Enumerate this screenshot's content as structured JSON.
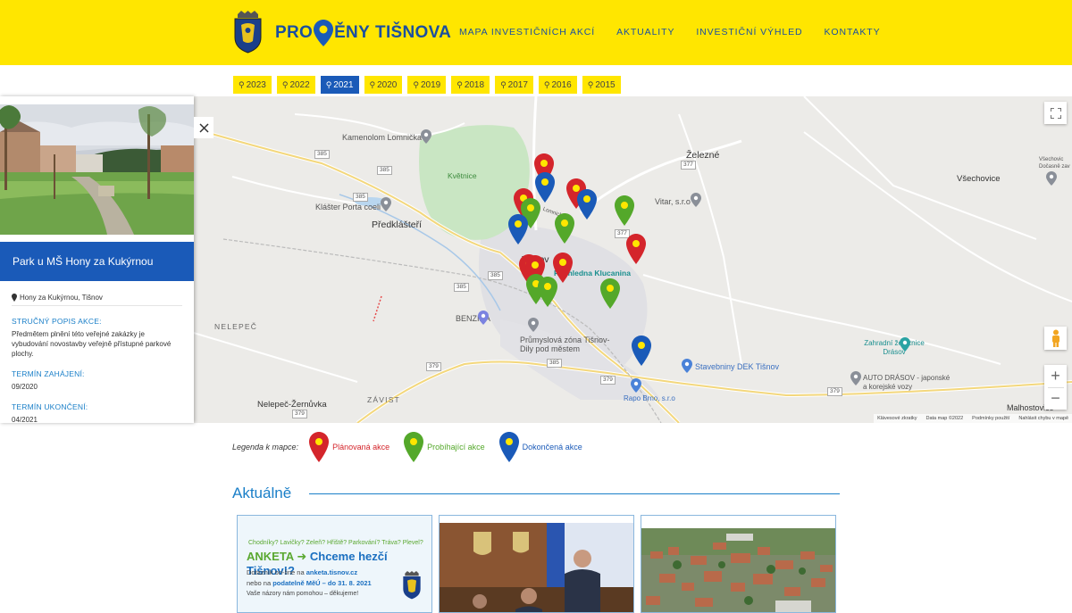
{
  "header": {
    "logo_part1": "PRO",
    "logo_part2": "ĚNY",
    "logo_part3": "TIŠNOVA",
    "nav": [
      "MAPA INVESTIČNÍCH AKCÍ",
      "AKTUALITY",
      "INVESTIČNÍ VÝHLED",
      "KONTAKTY"
    ]
  },
  "years": {
    "items": [
      "2023",
      "2022",
      "2021",
      "2020",
      "2019",
      "2018",
      "2017",
      "2016",
      "2015"
    ],
    "active": "2021"
  },
  "map": {
    "labels": {
      "kamenolom": "Kamenolom Lomnička",
      "kvetnice": "Květnice",
      "klaster": "Klášter Porta coeli",
      "predklasteri": "Předklášteří",
      "tisnov": "Tišnov",
      "rozhledna": "Rozhledna Klucanina",
      "benzina": "BENZINA",
      "prumyslova": "Průmyslová zóna Tišnov-Dily pod městem",
      "nelepec": "NELEPEČ",
      "nelepec_zernuvka": "Nelepeč-Žernůvka",
      "zavist": "ZÁVIST",
      "zelezne": "Železné",
      "vitar": "Vitar, s.r.o",
      "vsechovice": "Všechovice",
      "vsechovice_small": "Všechovic",
      "vsechovice_small2": "Dočasně zav",
      "zahradni": "Zahradní železnice Drásov",
      "stavebniny": "Stavebniny DEK Tišnov",
      "auto": "AUTO DRÁSOV - japonské a korejské vozy",
      "rapo": "Rapo Brno, s.r.o",
      "malhostovice": "Malhostovice",
      "lomnicka_road": "Lomnická"
    },
    "road_numbers": [
      "385",
      "385",
      "385",
      "385",
      "385",
      "379",
      "379",
      "379",
      "379",
      "377",
      "377",
      "385"
    ],
    "attribution": [
      "Klávesové zkratky",
      "Data map ©2022",
      "Podmínky použití",
      "Nahlásit chybu v mapě"
    ]
  },
  "panel": {
    "title": "Park u MŠ Hony za Kukýrnou",
    "address": "Hony za Kukýrnou, Tišnov",
    "desc_label": "STRUČNÝ POPIS AKCE:",
    "desc_text": "Předmětem plnění této veřejné zakázky je vybudování novostavby veřejně přístupné parkové plochy.",
    "start_label": "TERMÍN ZAHÁJENÍ:",
    "start_value": "09/2020",
    "end_label": "TERMÍN UKONČENÍ:",
    "end_value": "04/2021"
  },
  "legend": {
    "title": "Legenda k mapce:",
    "planned": "Plánovaná akce",
    "ongoing": "Probíhající akce",
    "done": "Dokončená akce"
  },
  "colors": {
    "yellow": "#ffe600",
    "blue": "#1a5ab8",
    "red": "#d4252b",
    "green": "#54a82a"
  },
  "news": {
    "title": "Aktuálně",
    "card1": {
      "line1": "Chodníky? Lavičky? Zeleň? Hřiště? Parkování? Tráva? Plevel?",
      "headline_a": "ANKETA",
      "headline_b": "Chceme hezčí Tišnov!?",
      "line3a": "Dotazník on-line na",
      "line3b": "anketa.tisnov.cz",
      "line4a": "nebo na",
      "line4b": "podatelně MěÚ",
      "line4c": "– do 31. 8. 2021",
      "line5": "Vaše názory nám pomohou – děkujeme!"
    }
  }
}
